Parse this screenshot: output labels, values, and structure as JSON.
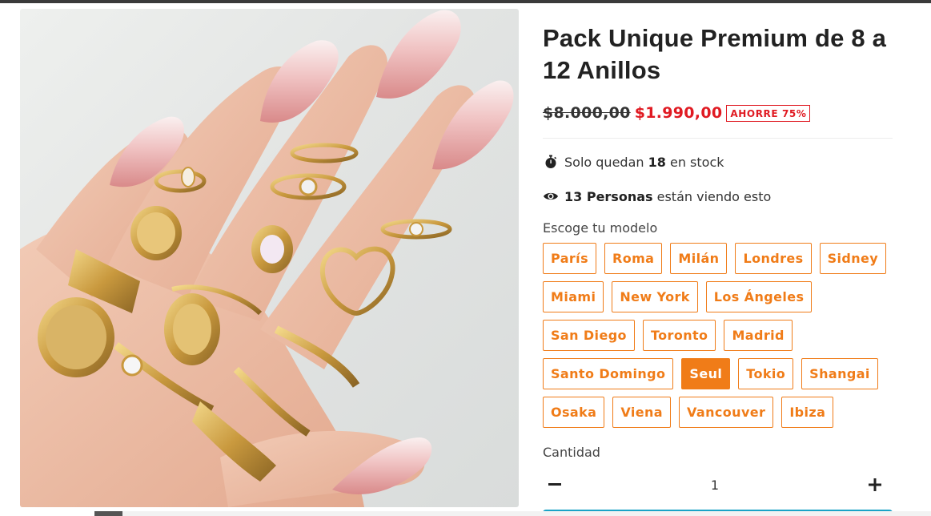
{
  "product": {
    "title": "Pack Unique Premium de 8 a 12 Anillos",
    "image_alt": "Mano con anillos dorados y uñas rosadas con brillo"
  },
  "price": {
    "old": "$8.000,00",
    "new": "$1.990,00",
    "badge": "AHORRE 75%"
  },
  "stock": {
    "prefix": "Solo quedan",
    "count": "18",
    "suffix": "en stock"
  },
  "viewers": {
    "count_label": "13 Personas",
    "suffix": "están viendo esto"
  },
  "model": {
    "label": "Escoge tu modelo",
    "selected": "Seul",
    "options": [
      "París",
      "Roma",
      "Milán",
      "Londres",
      "Sidney",
      "Miami",
      "New York",
      "Los Ángeles",
      "San Diego",
      "Toronto",
      "Madrid",
      "Santo Domingo",
      "Seul",
      "Tokio",
      "Shangai",
      "Osaka",
      "Viena",
      "Vancouver",
      "Ibiza"
    ]
  },
  "quantity": {
    "label": "Cantidad",
    "value": "1",
    "minus_icon": "minus-icon",
    "plus_icon": "plus-icon"
  },
  "colors": {
    "accent": "#f07c18",
    "sale": "#e01a22",
    "cta": "#1aa3c6"
  },
  "icons": {
    "stock": "stopwatch-icon",
    "viewers": "eye-icon"
  }
}
